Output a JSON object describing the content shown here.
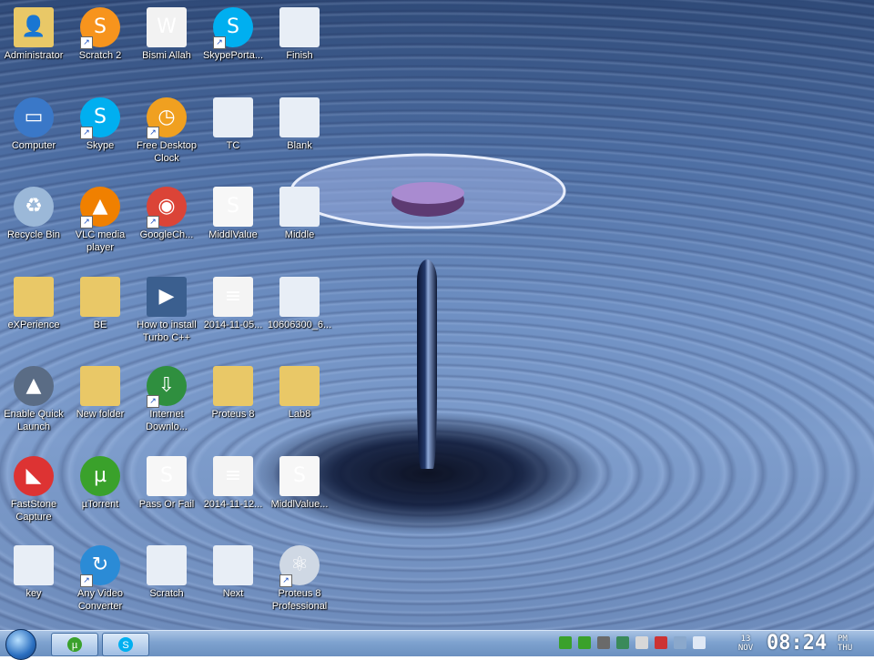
{
  "desktop": {
    "icons": [
      {
        "label": "Administrator",
        "icon": "user-folder-icon",
        "shortcut": false
      },
      {
        "label": "Scratch 2",
        "icon": "scratch-cat-icon",
        "shortcut": true
      },
      {
        "label": "Bismi Allah",
        "icon": "wma-file-icon",
        "shortcut": false
      },
      {
        "label": "SkypePorta...",
        "icon": "skype-icon",
        "shortcut": true
      },
      {
        "label": "Finish",
        "icon": "screenshot-file-icon",
        "shortcut": false
      },
      {
        "label": "Computer",
        "icon": "computer-icon",
        "shortcut": false
      },
      {
        "label": "Skype",
        "icon": "skype-icon",
        "shortcut": true
      },
      {
        "label": "Free Desktop Clock",
        "icon": "alarm-clock-icon",
        "shortcut": true
      },
      {
        "label": "TC",
        "icon": "screenshot-file-icon",
        "shortcut": false
      },
      {
        "label": "Blank",
        "icon": "screenshot-file-icon",
        "shortcut": false
      },
      {
        "label": "Recycle Bin",
        "icon": "recycle-bin-icon",
        "shortcut": false
      },
      {
        "label": "VLC media player",
        "icon": "vlc-cone-icon",
        "shortcut": true
      },
      {
        "label": "GoogleCh...",
        "icon": "chrome-icon",
        "shortcut": true
      },
      {
        "label": "MiddlValue",
        "icon": "scratch-file-icon",
        "shortcut": false
      },
      {
        "label": "Middle",
        "icon": "screenshot-file-icon",
        "shortcut": false
      },
      {
        "label": "eXPerience",
        "icon": "folder-icon",
        "shortcut": false
      },
      {
        "label": "BE",
        "icon": "folder-icon",
        "shortcut": false
      },
      {
        "label": "How to install Turbo C++",
        "icon": "video-file-icon",
        "shortcut": false
      },
      {
        "label": "2014-11-05...",
        "icon": "document-file-icon",
        "shortcut": false
      },
      {
        "label": "10606300_6...",
        "icon": "screenshot-file-icon",
        "shortcut": false
      },
      {
        "label": "Enable Quick Launch",
        "icon": "quick-launch-icon",
        "shortcut": false
      },
      {
        "label": "New folder",
        "icon": "folder-icon",
        "shortcut": false
      },
      {
        "label": "Internet Downlo...",
        "icon": "internet-download-icon",
        "shortcut": true
      },
      {
        "label": "Proteus 8",
        "icon": "folder-icon",
        "shortcut": false
      },
      {
        "label": "Lab8",
        "icon": "folder-icon",
        "shortcut": false
      },
      {
        "label": "FastStone Capture",
        "icon": "faststone-icon",
        "shortcut": false
      },
      {
        "label": "µTorrent",
        "icon": "utorrent-icon",
        "shortcut": false
      },
      {
        "label": "Pass Or Fail",
        "icon": "scratch-file-icon",
        "shortcut": false
      },
      {
        "label": "2014-11-12...",
        "icon": "document-file-icon",
        "shortcut": false
      },
      {
        "label": "MiddlValue...",
        "icon": "scratch-file-icon",
        "shortcut": false
      },
      {
        "label": "key",
        "icon": "screenshot-file-icon",
        "shortcut": false
      },
      {
        "label": "Any Video Converter",
        "icon": "video-converter-icon",
        "shortcut": true
      },
      {
        "label": "Scratch",
        "icon": "screenshot-file-icon",
        "shortcut": false
      },
      {
        "label": "Next",
        "icon": "screenshot-file-icon",
        "shortcut": false
      },
      {
        "label": "Proteus 8 Professional",
        "icon": "proteus-atom-icon",
        "shortcut": true
      }
    ]
  },
  "taskbar": {
    "start_icon": "windows-start-icon",
    "pinned": [
      {
        "icon": "utorrent-icon"
      },
      {
        "icon": "skype-icon"
      }
    ],
    "tray_icons": [
      "utorrent-tray-icon",
      "torrent-tray-icon",
      "battery-tray-icon",
      "network-tray-icon",
      "document-tray-icon",
      "flag-tray-icon",
      "display-tray-icon",
      "volume-tray-icon"
    ],
    "date_day": "13",
    "date_month": "NOV",
    "time": "08:24",
    "ampm": "PM",
    "weekday": "THU"
  },
  "colors": {
    "taskbar": "#7ea2cf",
    "label_text": "#ffffff",
    "skype": "#00aff0",
    "folder": "#e9c867",
    "scratch": "#f7941d"
  }
}
